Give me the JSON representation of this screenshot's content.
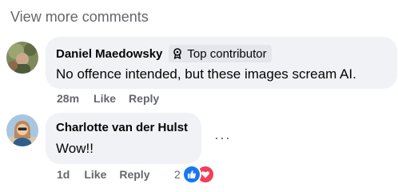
{
  "view_more": "View more comments",
  "comments": [
    {
      "author": "Daniel Maedowsky",
      "badge": "Top contributor",
      "badge_icon": "top-contributor-icon",
      "text": "No offence intended, but these images scream AI.",
      "time": "28m",
      "like_label": "Like",
      "reply_label": "Reply"
    },
    {
      "author": "Charlotte van der Hulst",
      "text": "Wow!!",
      "time": "1d",
      "like_label": "Like",
      "reply_label": "Reply",
      "more_icon": "more-options-icon",
      "reaction_count": "2",
      "reactions": [
        "like-reaction-icon",
        "love-reaction-icon"
      ]
    }
  ],
  "colors": {
    "bubble_bg": "#f0f2f5",
    "secondary_text": "#65676b",
    "like_blue": "#1877f2",
    "love_red": "#f33e58"
  }
}
